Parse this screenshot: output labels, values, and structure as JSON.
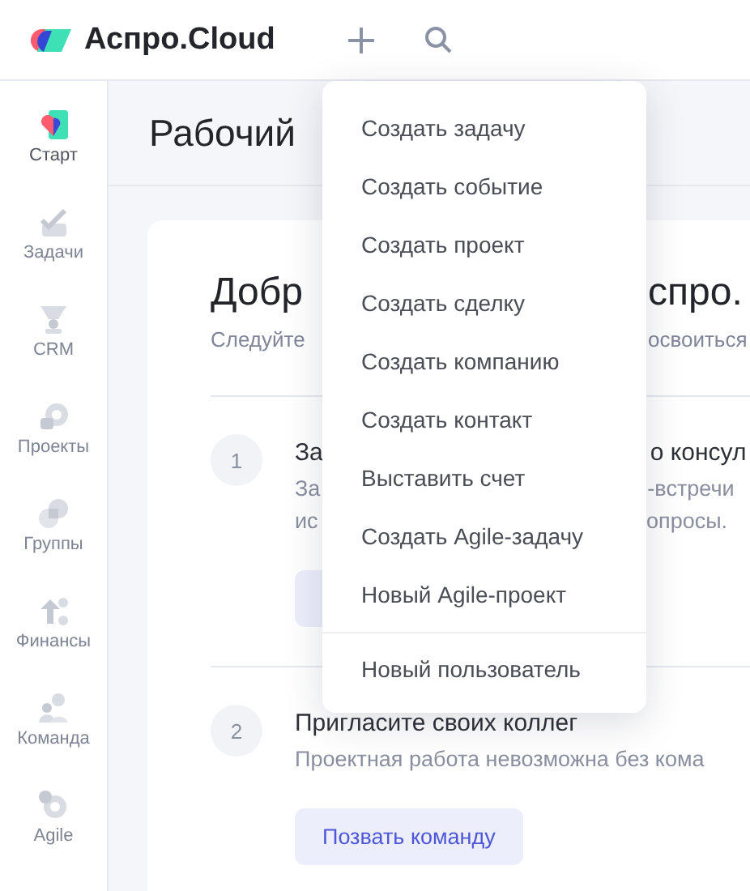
{
  "topbar": {
    "logo_text": "Аспро.Cloud"
  },
  "sidebar": {
    "items": [
      {
        "label": "Старт",
        "kind": "start",
        "selected": true
      },
      {
        "label": "Задачи",
        "kind": "tasks",
        "selected": false
      },
      {
        "label": "CRM",
        "kind": "crm",
        "selected": false
      },
      {
        "label": "Проекты",
        "kind": "projects",
        "selected": false
      },
      {
        "label": "Группы",
        "kind": "groups",
        "selected": false
      },
      {
        "label": "Финансы",
        "kind": "finance",
        "selected": false
      },
      {
        "label": "Команда",
        "kind": "team",
        "selected": false
      },
      {
        "label": "Agile",
        "kind": "agile",
        "selected": false
      }
    ]
  },
  "page_title": "Рабочий",
  "welcome": {
    "title": [
      "Добр",
      "спро."
    ],
    "subtitle": [
      "Следуйте",
      "освоиться"
    ]
  },
  "steps": [
    {
      "number": "1",
      "title": [
        "За",
        "о консул"
      ],
      "description": [
        [
          "За",
          "-встречи"
        ],
        [
          "ис",
          "опросы."
        ]
      ],
      "button": {
        "covered": true
      }
    },
    {
      "number": "2",
      "title": [
        "Пригласите своих коллег"
      ],
      "description": [
        [
          "Проектная работа невозможна без кома"
        ]
      ],
      "button": {
        "covered": false,
        "label": "Позвать команду"
      }
    }
  ],
  "menu": {
    "items": [
      "Создать задачу",
      "Создать событие",
      "Создать проект",
      "Создать сделку",
      "Создать компанию",
      "Создать контакт",
      "Выставить счет",
      "Создать Agile-задачу",
      "Новый Agile-проект"
    ],
    "footer_items": [
      "Новый пользователь"
    ]
  }
}
